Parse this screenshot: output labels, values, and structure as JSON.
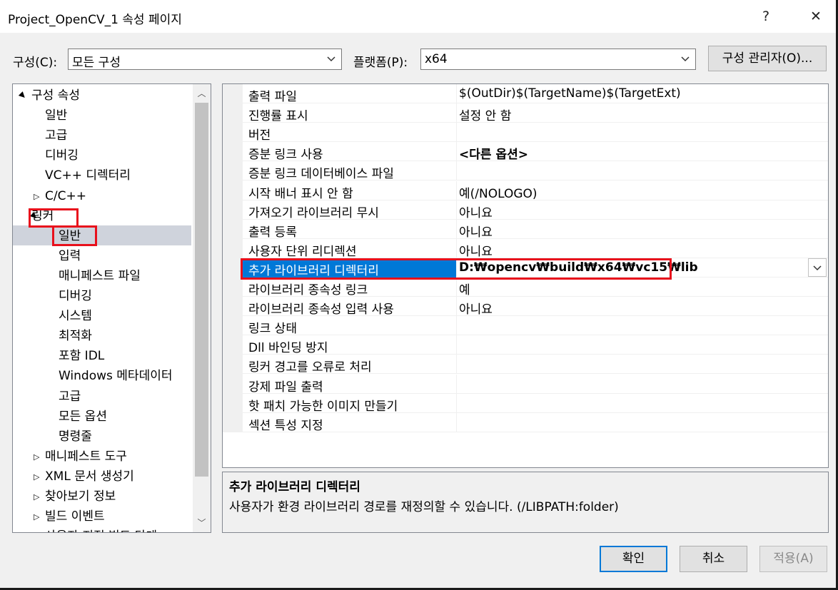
{
  "window": {
    "title": "Project_OpenCV_1 속성 페이지",
    "help_glyph": "?",
    "close_glyph": "✕"
  },
  "toolbar": {
    "config_label": "구성(C):",
    "config_value": "모든 구성",
    "platform_label": "플랫폼(P):",
    "platform_value": "x64",
    "config_manager_label": "구성 관리자(O)..."
  },
  "tree": {
    "items": [
      {
        "label": "구성 속성",
        "expander": "▲"
      },
      {
        "label": "일반"
      },
      {
        "label": "고급"
      },
      {
        "label": "디버깅"
      },
      {
        "label": "VC++ 디렉터리"
      },
      {
        "label": "C/C++",
        "expander": "▷"
      },
      {
        "label": "링커",
        "expander": "▲"
      },
      {
        "label": "일반"
      },
      {
        "label": "입력"
      },
      {
        "label": "매니페스트 파일"
      },
      {
        "label": "디버깅"
      },
      {
        "label": "시스템"
      },
      {
        "label": "최적화"
      },
      {
        "label": "포함 IDL"
      },
      {
        "label": "Windows 메타데이터"
      },
      {
        "label": "고급"
      },
      {
        "label": "모든 옵션"
      },
      {
        "label": "명령줄"
      },
      {
        "label": "매니페스트 도구",
        "expander": "▷"
      },
      {
        "label": "XML 문서 생성기",
        "expander": "▷"
      },
      {
        "label": "찾아보기 정보",
        "expander": "▷"
      },
      {
        "label": "빌드 이벤트",
        "expander": "▷"
      },
      {
        "label": "사용자 지정 빌드 단계",
        "expander": "▷"
      }
    ],
    "selected": "일반"
  },
  "properties": [
    {
      "name": "출력 파일",
      "value": "$(OutDir)$(TargetName)$(TargetExt)"
    },
    {
      "name": "진행률 표시",
      "value": "설정 안 함"
    },
    {
      "name": "버전",
      "value": ""
    },
    {
      "name": "증분 링크 사용",
      "value": "<다른 옵션>"
    },
    {
      "name": "증분 링크 데이터베이스 파일",
      "value": ""
    },
    {
      "name": "시작 배너 표시 안 함",
      "value": "예(/NOLOGO)"
    },
    {
      "name": "가져오기 라이브러리 무시",
      "value": "아니요"
    },
    {
      "name": "출력 등록",
      "value": "아니요"
    },
    {
      "name": "사용자 단위 리디렉션",
      "value": "아니요"
    },
    {
      "name": "추가 라이브러리 디렉터리",
      "value": "D:₩opencv₩build₩x64₩vc15₩lib"
    },
    {
      "name": "라이브러리 종속성 링크",
      "value": "예"
    },
    {
      "name": "라이브러리 종속성 입력 사용",
      "value": "아니요"
    },
    {
      "name": "링크 상태",
      "value": ""
    },
    {
      "name": "Dll 바인딩 방지",
      "value": ""
    },
    {
      "name": "링커 경고를 오류로 처리",
      "value": ""
    },
    {
      "name": "강제 파일 출력",
      "value": ""
    },
    {
      "name": "핫 패치 가능한 이미지 만들기",
      "value": ""
    },
    {
      "name": "섹션 특성 지정",
      "value": ""
    }
  ],
  "description": {
    "title": "추가 라이브러리 디렉터리",
    "text": "사용자가 환경 라이브러리 경로를 재정의할 수 있습니다. (/LIBPATH:folder)"
  },
  "buttons": {
    "ok": "확인",
    "cancel": "취소",
    "apply": "적용(A)"
  },
  "colors": {
    "selection_blue": "#0078d7",
    "annotation_red": "#e8101c"
  }
}
